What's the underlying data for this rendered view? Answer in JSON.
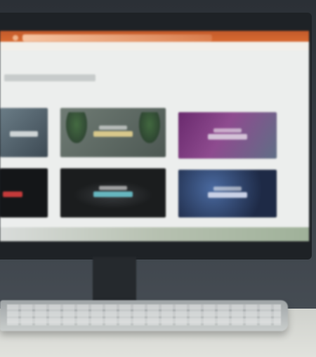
{
  "scene": {
    "description_labels": {
      "screen_header_title": "",
      "section_heading": ""
    },
    "screen": {
      "accent_color": "#d86a32",
      "background_color": "#eceeed",
      "tiles": [
        {
          "label": ""
        },
        {
          "label": ""
        },
        {
          "label": ""
        },
        {
          "label": ""
        },
        {
          "label": ""
        },
        {
          "label": ""
        }
      ]
    },
    "colors": {
      "bezel": "#1e2226",
      "desk": "#e1e2dd",
      "keyboard": "#b7bbbb"
    }
  }
}
